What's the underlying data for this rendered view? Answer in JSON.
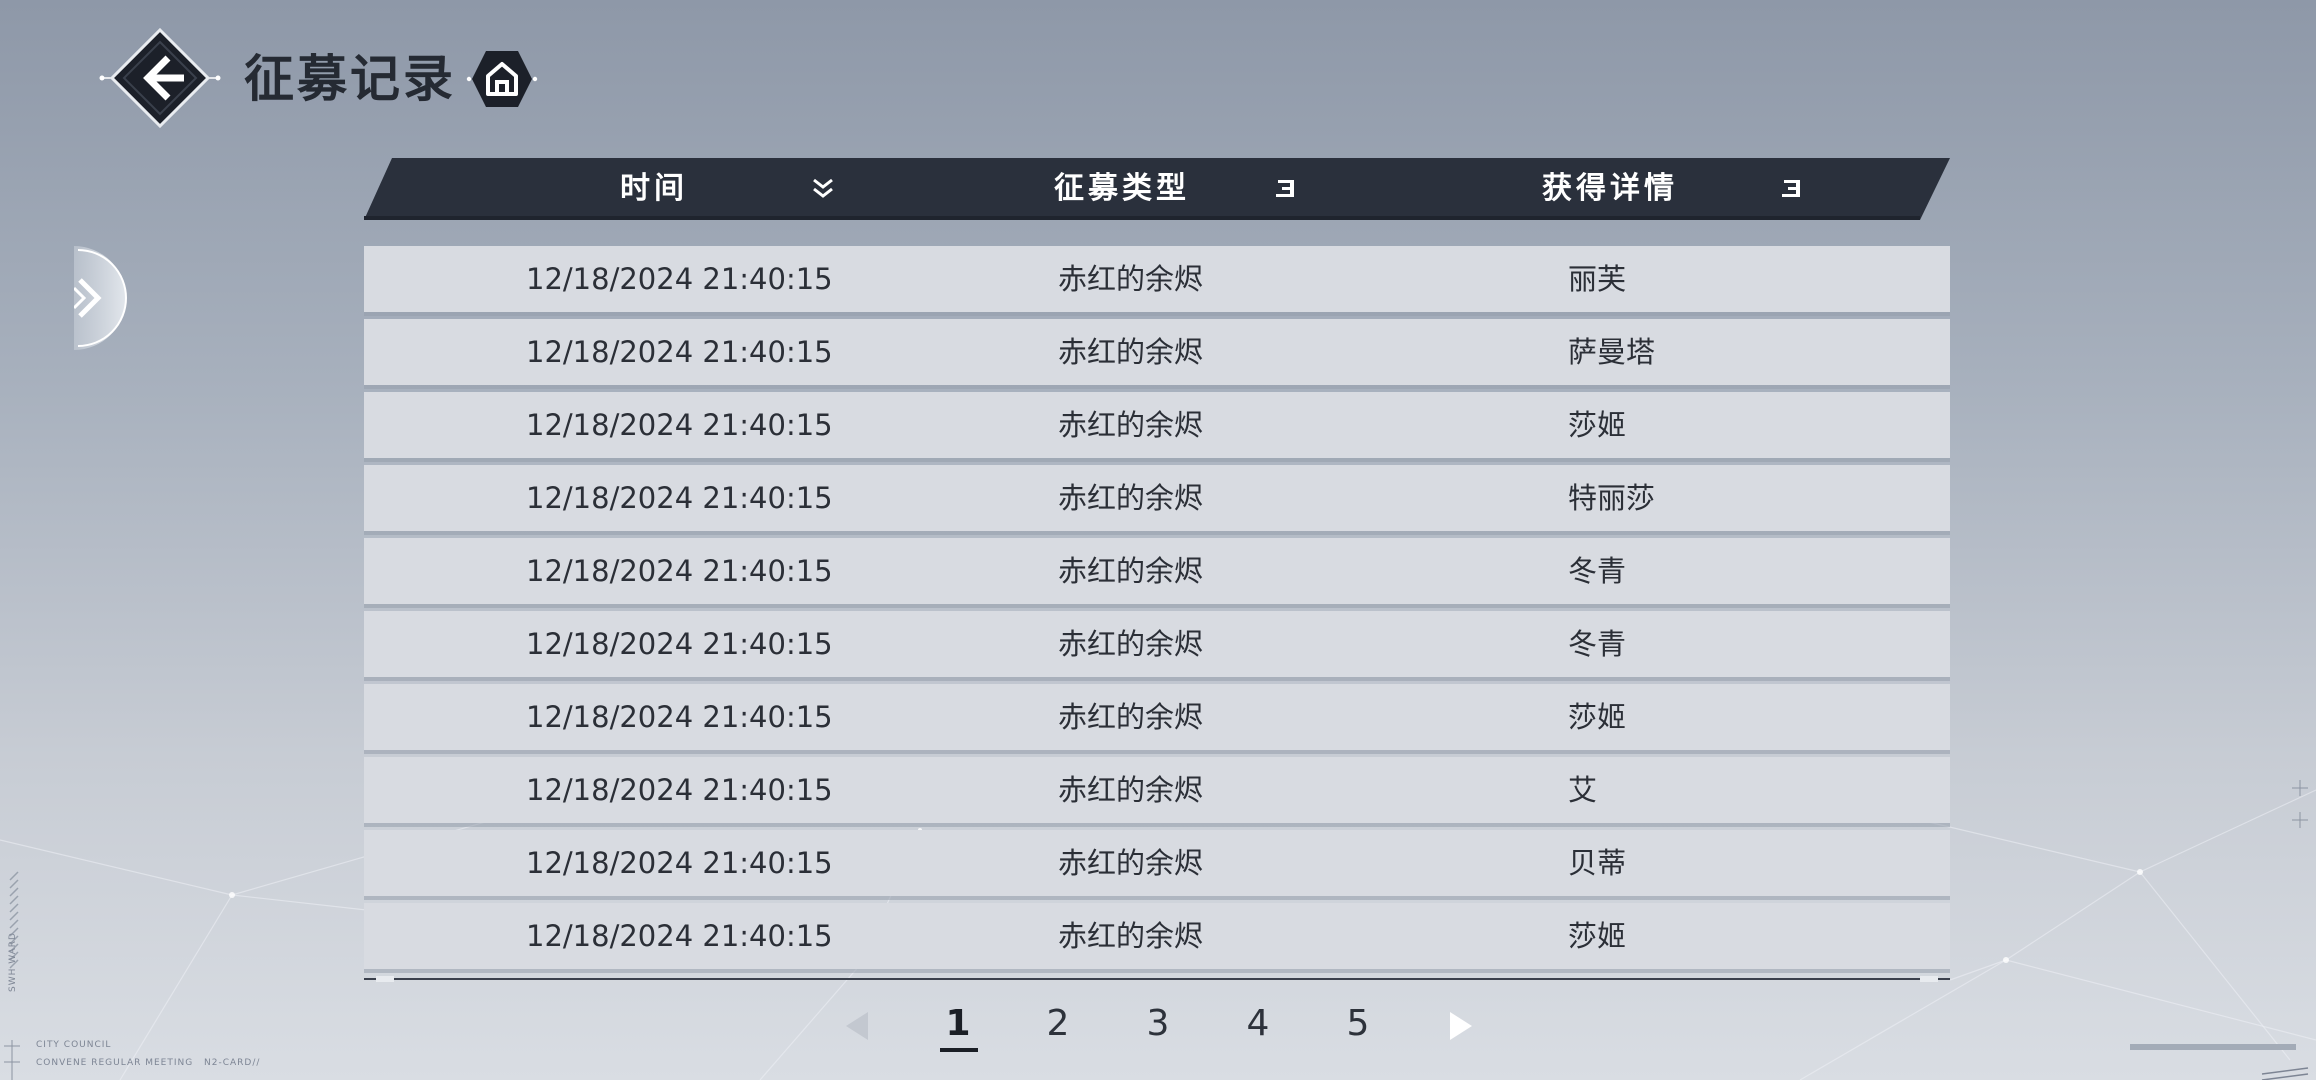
{
  "header": {
    "title": "征募记录"
  },
  "table": {
    "columns": [
      {
        "label": "时间",
        "icon": "double-chevron-down-icon"
      },
      {
        "label": "征募类型",
        "icon": "filter-lines-icon"
      },
      {
        "label": "获得详情",
        "icon": "filter-lines-icon"
      }
    ],
    "rows": [
      {
        "time": "12/18/2024 21:40:15",
        "type": "赤红的余烬",
        "detail": "丽芙"
      },
      {
        "time": "12/18/2024 21:40:15",
        "type": "赤红的余烬",
        "detail": "萨曼塔"
      },
      {
        "time": "12/18/2024 21:40:15",
        "type": "赤红的余烬",
        "detail": "莎姬"
      },
      {
        "time": "12/18/2024 21:40:15",
        "type": "赤红的余烬",
        "detail": "特丽莎"
      },
      {
        "time": "12/18/2024 21:40:15",
        "type": "赤红的余烬",
        "detail": "冬青"
      },
      {
        "time": "12/18/2024 21:40:15",
        "type": "赤红的余烬",
        "detail": "冬青"
      },
      {
        "time": "12/18/2024 21:40:15",
        "type": "赤红的余烬",
        "detail": "莎姬"
      },
      {
        "time": "12/18/2024 21:40:15",
        "type": "赤红的余烬",
        "detail": "艾"
      },
      {
        "time": "12/18/2024 21:40:15",
        "type": "赤红的余烬",
        "detail": "贝蒂"
      },
      {
        "time": "12/18/2024 21:40:15",
        "type": "赤红的余烬",
        "detail": "莎姬"
      }
    ]
  },
  "pagination": {
    "pages": [
      "1",
      "2",
      "3",
      "4",
      "5"
    ],
    "current": "1"
  },
  "decor": {
    "left_lines": [
      "CITY COUNCIL",
      "CONVENE REGULAR MEETING",
      "N2-CARD//"
    ],
    "left_vertical": "SWH WARD"
  },
  "colors": {
    "header_bar": "#2a303c",
    "row_bg": "#d8dbe1",
    "text_dark": "#252a33"
  }
}
